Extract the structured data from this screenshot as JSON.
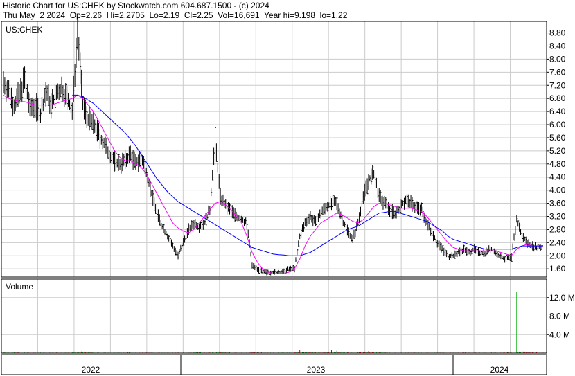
{
  "header": {
    "line1": "Historic Chart for US:CHEK by Stockwatch.com 604.687.1500 - (c) 2024",
    "line2": "Thu May  2 2024  Op=2.26  Hi=2.2705  Lo=2.19  Cl=2.25  Vol=16,691  Year hi=9.198  lo=1.22"
  },
  "chart_data": [
    {
      "type": "line",
      "title": "US:CHEK",
      "y_ticks": [
        "8.80",
        "8.40",
        "8.00",
        "7.60",
        "7.20",
        "6.80",
        "6.40",
        "6.00",
        "5.60",
        "5.20",
        "4.80",
        "4.40",
        "4.00",
        "3.60",
        "3.20",
        "2.80",
        "2.40",
        "2.00",
        "1.60"
      ],
      "ylim": [
        1.35,
        9.15
      ],
      "x_labels": [
        "2022",
        "2023",
        "2024"
      ],
      "grid": true,
      "colors": {
        "price": "#000000",
        "ma_short": "#ff00ff",
        "ma_long": "#0000ff"
      },
      "series": [
        {
          "key": "price",
          "values": [
            7.3,
            7.0,
            6.6,
            6.9,
            7.4,
            6.5,
            6.6,
            6.3,
            7.0,
            6.6,
            6.9,
            7.1,
            6.8,
            6.4,
            8.9,
            6.6,
            6.2,
            6.0,
            5.7,
            5.4,
            5.1,
            4.9,
            4.8,
            4.9,
            5.1,
            4.8,
            5.0,
            4.6,
            3.9,
            3.3,
            2.9,
            2.6,
            2.3,
            2.0,
            2.4,
            2.8,
            3.0,
            2.9,
            3.0,
            3.4,
            5.6,
            3.8,
            3.5,
            3.4,
            3.2,
            3.1,
            3.0,
            1.7,
            1.6,
            1.5,
            1.5,
            1.5,
            1.5,
            1.5,
            1.6,
            1.6,
            2.6,
            3.0,
            3.2,
            3.0,
            3.3,
            3.5,
            3.6,
            3.6,
            3.1,
            2.8,
            2.5,
            3.0,
            3.8,
            4.3,
            4.5,
            3.8,
            3.6,
            3.4,
            3.3,
            3.5,
            3.7,
            3.6,
            3.5,
            3.4,
            3.0,
            2.7,
            2.4,
            2.2,
            2.0,
            2.0,
            2.1,
            2.2,
            2.1,
            2.2,
            2.1,
            2.1,
            2.2,
            2.1,
            1.95,
            1.9,
            1.95,
            3.1,
            2.6,
            2.4,
            2.3,
            2.25,
            2.25
          ]
        },
        {
          "key": "ma_short",
          "values": [
            6.9,
            6.8,
            6.75,
            6.7,
            6.7,
            6.65,
            6.6,
            6.6,
            6.6,
            6.6,
            6.65,
            6.7,
            6.75,
            6.8,
            6.9,
            6.8,
            6.6,
            6.4,
            6.1,
            5.8,
            5.5,
            5.2,
            5.0,
            4.9,
            4.9,
            4.8,
            4.7,
            4.5,
            4.2,
            3.9,
            3.6,
            3.3,
            3.0,
            2.85,
            2.75,
            2.7,
            2.8,
            3.0,
            3.2,
            3.4,
            3.6,
            3.65,
            3.55,
            3.4,
            3.2,
            3.0,
            2.6,
            2.1,
            1.8,
            1.6,
            1.5,
            1.45,
            1.45,
            1.45,
            1.5,
            1.6,
            1.9,
            2.3,
            2.6,
            2.8,
            3.0,
            3.1,
            3.2,
            3.3,
            3.25,
            3.15,
            3.05,
            3.0,
            3.1,
            3.3,
            3.5,
            3.6,
            3.6,
            3.55,
            3.5,
            3.45,
            3.45,
            3.45,
            3.4,
            3.35,
            3.2,
            3.0,
            2.8,
            2.6,
            2.4,
            2.25,
            2.2,
            2.15,
            2.15,
            2.15,
            2.15,
            2.15,
            2.15,
            2.15,
            2.1,
            2.05,
            2.0,
            2.2,
            2.3,
            2.35,
            2.3,
            2.3,
            2.3
          ]
        },
        {
          "key": "ma_long",
          "values": [
            null,
            null,
            null,
            null,
            null,
            null,
            null,
            null,
            null,
            null,
            null,
            null,
            null,
            6.9,
            6.9,
            6.85,
            6.75,
            6.65,
            6.5,
            6.35,
            6.2,
            6.05,
            5.9,
            5.75,
            5.55,
            5.35,
            5.1,
            4.85,
            4.6,
            4.35,
            4.15,
            3.95,
            3.8,
            3.65,
            3.55,
            3.45,
            3.35,
            3.25,
            3.15,
            3.05,
            2.95,
            2.85,
            2.75,
            2.65,
            2.55,
            2.45,
            2.35,
            2.25,
            2.2,
            2.15,
            2.1,
            2.05,
            2.03,
            2.02,
            2.0,
            2.0,
            2.0,
            2.05,
            2.1,
            2.2,
            2.3,
            2.4,
            2.5,
            2.6,
            2.7,
            2.8,
            2.85,
            2.9,
            3.0,
            3.1,
            3.2,
            3.3,
            3.32,
            3.35,
            3.35,
            3.3,
            3.25,
            3.2,
            3.15,
            3.1,
            3.05,
            2.95,
            2.85,
            2.75,
            2.6,
            2.5,
            2.45,
            2.4,
            2.35,
            2.3,
            2.25,
            2.2,
            2.2,
            2.2,
            2.2,
            2.2,
            2.2,
            2.25,
            2.3,
            2.3,
            2.3,
            2.3,
            2.3
          ]
        }
      ]
    },
    {
      "type": "bar",
      "title": "Volume",
      "y_ticks": [
        "12.0 M",
        "8.0 M",
        "4.0 M"
      ],
      "ylim": [
        0,
        16
      ],
      "colors": {
        "volume": "#00aa00",
        "volume_down": "#dd0000"
      },
      "series": [
        {
          "key": "volume",
          "values": [
            0.15,
            0.1,
            0.15,
            0.1,
            0.12,
            0.1,
            0.1,
            0.12,
            0.1,
            0.1,
            0.12,
            0.1,
            0.1,
            0.15,
            0.3,
            0.2,
            0.15,
            0.1,
            0.1,
            0.12,
            0.1,
            0.1,
            0.1,
            0.15,
            0.1,
            0.1,
            0.1,
            0.12,
            0.1,
            0.1,
            0.1,
            0.1,
            0.1,
            0.12,
            0.1,
            0.1,
            0.2,
            0.15,
            0.1,
            0.12,
            0.4,
            0.2,
            0.15,
            0.1,
            0.1,
            0.1,
            0.12,
            0.3,
            0.2,
            0.1,
            0.1,
            0.1,
            0.12,
            0.1,
            0.1,
            0.15,
            0.6,
            0.3,
            0.2,
            0.15,
            0.2,
            0.3,
            0.6,
            0.5,
            0.2,
            0.15,
            0.1,
            0.2,
            0.3,
            0.4,
            0.3,
            0.2,
            0.15,
            0.1,
            0.1,
            0.12,
            0.1,
            0.1,
            0.12,
            0.1,
            0.1,
            0.1,
            0.12,
            0.1,
            0.1,
            0.1,
            0.1,
            0.12,
            0.1,
            0.1,
            0.1,
            0.1,
            0.12,
            0.1,
            0.1,
            0.15,
            0.1,
            13.2,
            0.5,
            0.2,
            0.15,
            0.1,
            0.1
          ]
        }
      ]
    }
  ]
}
